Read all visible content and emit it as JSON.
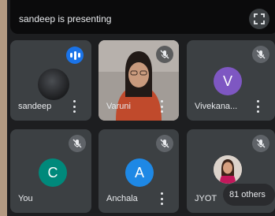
{
  "presentation": {
    "banner_text": "sandeep is presenting",
    "fullscreen_icon": "fullscreen-icon"
  },
  "participants": [
    {
      "name": "sandeep",
      "avatar_type": "dark-photo",
      "status": "speaking",
      "status_icon": "audio-level-icon"
    },
    {
      "name": "Varuni",
      "avatar_type": "video",
      "status": "muted",
      "status_icon": "mic-off-icon"
    },
    {
      "name": "Vivekana...",
      "avatar_letter": "V",
      "avatar_color": "#7e57c2",
      "status": "muted",
      "status_icon": "mic-off-icon"
    },
    {
      "name": "You",
      "avatar_letter": "C",
      "avatar_color": "#00897b",
      "status": "muted",
      "status_icon": "mic-off-icon"
    },
    {
      "name": "Anchala",
      "avatar_letter": "A",
      "avatar_color": "#1e88e5",
      "status": "muted",
      "status_icon": "mic-off-icon"
    },
    {
      "name": "JYOT",
      "avatar_type": "photo",
      "status": "muted",
      "status_icon": "mic-off-icon"
    }
  ],
  "others": {
    "label": "81 others"
  },
  "colors": {
    "tile_background": "#3c4043",
    "speaking_accent": "#1a73e8"
  }
}
